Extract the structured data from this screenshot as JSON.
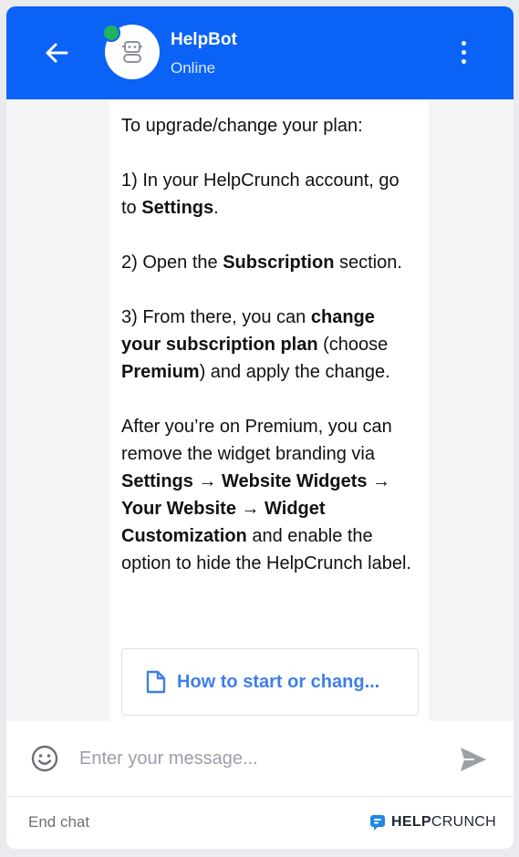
{
  "header": {
    "back_icon": "arrow-left-icon",
    "bot_name": "HelpBot",
    "bot_status": "Online",
    "status_color": "#20b35c",
    "menu_icon": "more-vertical-icon",
    "background": "#0b62f6"
  },
  "message": {
    "intro": "To upgrade/change your plan:",
    "step1_pre": "1) In your HelpCrunch account, go to ",
    "step1_bold": "Settings",
    "step1_post": ".",
    "step2_pre": "2) Open the ",
    "step2_bold": "Subscription",
    "step2_post": " section.",
    "step3_pre": "3) From there, you can ",
    "step3_bold1": "change your subscription plan",
    "step3_mid": " (choose ",
    "step3_bold2": "Premium",
    "step3_post": ") and apply the change.",
    "after_pre": "After you’re on Premium, you can remove the widget branding via ",
    "after_bold": "Settings → Website Widgets → Your Website → Widget Customization",
    "after_post": " and enable the option to hide the HelpCrunch label."
  },
  "article": {
    "icon": "document-icon",
    "title": "How to start or chang..."
  },
  "composer": {
    "emoji_icon": "smiley-icon",
    "placeholder": "Enter your message...",
    "send_icon": "send-icon"
  },
  "footer": {
    "end_chat": "End chat",
    "brand_strong": "HELP",
    "brand_light": "CRUNCH"
  }
}
